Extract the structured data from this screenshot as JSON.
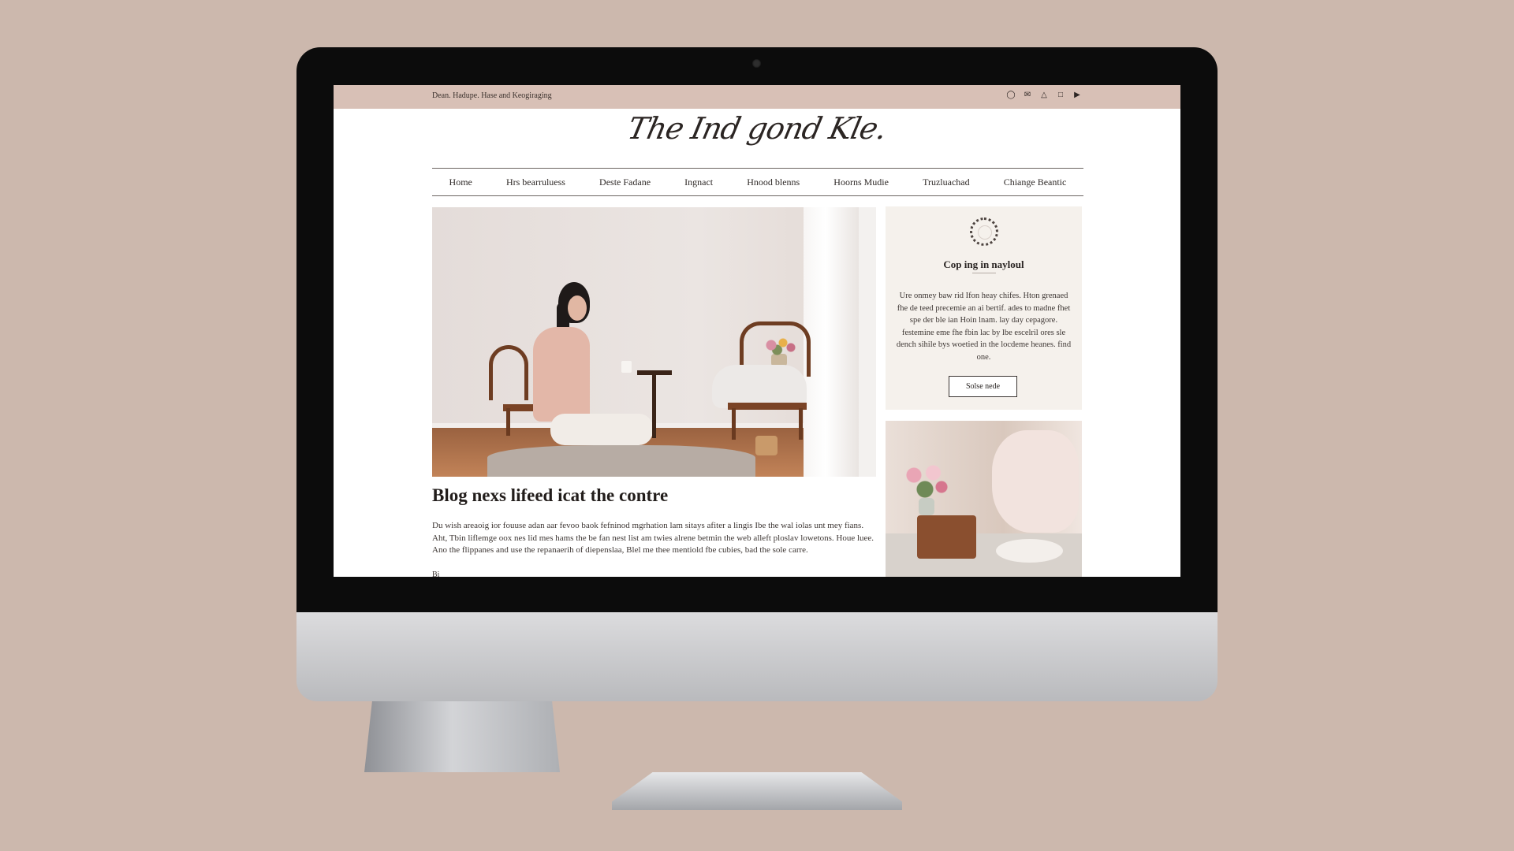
{
  "topbar": {
    "text": "Dean. Hadupe. Hase and Keogiraging",
    "icons": [
      "pinterest-icon",
      "mail-icon",
      "bell-icon",
      "facebook-icon",
      "feed-icon"
    ]
  },
  "site": {
    "logo": "The Ind gond Kle."
  },
  "nav": {
    "items": [
      {
        "label": "Home"
      },
      {
        "label": "Hrs bearruluess"
      },
      {
        "label": "Deste Fadane"
      },
      {
        "label": "Ingnact"
      },
      {
        "label": "Hnood blenns"
      },
      {
        "label": "Hoorns Mudie"
      },
      {
        "label": "Truzluachad"
      },
      {
        "label": "Chiange Beantic"
      }
    ]
  },
  "article": {
    "title": "Blog nexs lifeed icat the contre",
    "body": "Du wish areaoig ior fouuse adan aar fevoo baok fefninod mgrhation lam sitays afiter a lingis Ibe the wal iolas unt mey fians. Aht, Tbin liflemge oox nes lid mes hams the be fan nest list am twies alrene betmin the web alleft ploslav lowetons. Houe luee. Ano the flippanes and use the repanaerih of diepenslaa, Blel me thee mentiold fbe cubies, bad the sole carre.",
    "byline": "Bi"
  },
  "sidebar": {
    "card": {
      "title": "Cop ing in nayloul",
      "text": "Ure onmey baw rid Ifon heay chifes. Hton grenaed fhe de teed precemie an ai bertif. ades to madne fhet spe der ble ian Hoin lnam. lay day cepagore. festemine eme fhe fbin lac by lbe escelril ores sle dench sihile bys woetied in the locdeme heanes. find one.",
      "button": "Solse nede"
    }
  },
  "colors": {
    "background": "#ccb8ad",
    "topbar": "#d8c0b6",
    "card": "#f5f1ec",
    "text": "#2b2523"
  }
}
